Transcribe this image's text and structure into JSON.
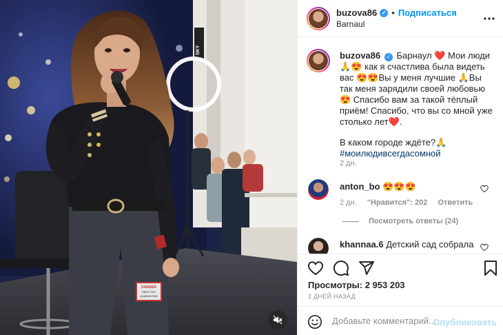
{
  "post": {
    "username": "buzova86",
    "follow_label": "Подписаться",
    "separator": "•",
    "location": "Barnaul",
    "caption_line1": "Барнаул ❤️ Мои люди",
    "caption_line2": "🙏😍 как я счастлива была видеть",
    "caption_line3": "вас 😍😍Вы у меня лучшие 🙏Вы",
    "caption_line4": "так меня зарядили своей любовью",
    "caption_line5": "😍 Спасибо вам за такой тёплый",
    "caption_line6": "приём! Спасибо, что вы со мной уже",
    "caption_line7": "столько лет❤️.",
    "caption_question": "В каком городе ждёте?🙏",
    "hashtag": "#моилюдивсегдасомной",
    "caption_time": "2 дн."
  },
  "comments": [
    {
      "username": "anton_bo",
      "text": "😍😍😍",
      "time": "2 дн.",
      "likes": "\"Нравится\": 202",
      "reply_label": "Ответить",
      "replies_label": "Посмотреть ответы (24)"
    },
    {
      "username": "khannaa.6",
      "text": "Детский сад собрала"
    }
  ],
  "actions": {
    "views": "Просмотры: 2 953 203",
    "ago": "2 ДНЕЙ НАЗАД"
  },
  "add_comment": {
    "placeholder": "Добавьте комментарий...",
    "publish_label": "Опубликовать"
  },
  "video": {
    "sticker_line1": "DANGER",
    "sticker_line2": "KEEP OUT",
    "sticker_line3": "QUARANTINE",
    "sign_text": "SKY"
  },
  "colors": {
    "accent_blue": "#0095f6",
    "publish_disabled": "#b2dffc",
    "hashtag": "#00376b",
    "heart_red": "#ed4956"
  },
  "icons": {
    "verified": "verified-badge-icon",
    "more": "more-options-icon",
    "like": "heart-icon",
    "comment": "comment-bubble-icon",
    "share": "paper-plane-icon",
    "save": "bookmark-icon",
    "emoji": "emoji-icon",
    "mute": "speaker-muted-icon"
  }
}
